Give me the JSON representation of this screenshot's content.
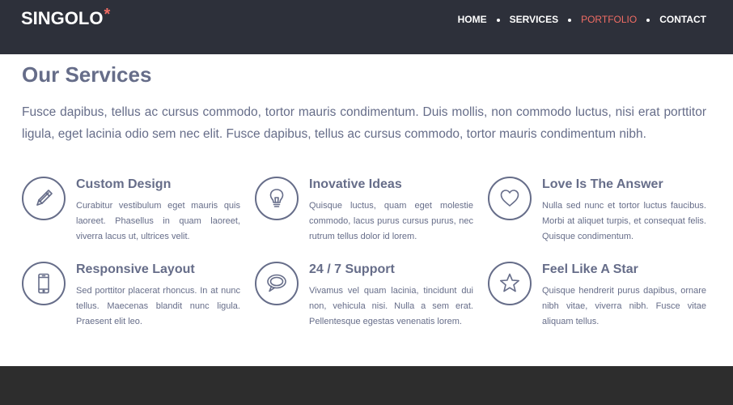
{
  "header": {
    "logo_text": "SINGOLO",
    "logo_mark": "*",
    "nav": [
      {
        "label": "HOME",
        "active": false
      },
      {
        "label": "SERVICES",
        "active": false
      },
      {
        "label": "PORTFOLIO",
        "active": true
      },
      {
        "label": "CONTACT",
        "active": false
      }
    ]
  },
  "services": {
    "title": "Our Services",
    "intro": "Fusce dapibus, tellus ac cursus commodo, tortor mauris condimentum. Duis mollis, non commodo luctus, nisi erat porttitor ligula, eget lacinia odio sem nec elit. Fusce dapibus, tellus ac cursus commodo, tortor mauris condimentum nibh.",
    "items": [
      {
        "icon": "pencil-icon",
        "title": "Custom Design",
        "text": "Curabitur vestibulum eget mauris quis laoreet. Phasellus in quam laoreet, viverra lacus ut, ultrices velit."
      },
      {
        "icon": "lightbulb-icon",
        "title": "Inovative Ideas",
        "text": "Quisque luctus, quam eget molestie commodo, lacus purus cursus purus, nec rutrum tellus dolor id lorem."
      },
      {
        "icon": "heart-icon",
        "title": "Love Is The Answer",
        "text": "Nulla sed nunc et tortor luctus faucibus. Morbi at aliquet turpis, et consequat felis. Quisque condimentum."
      },
      {
        "icon": "smartphone-icon",
        "title": "Responsive Layout",
        "text": "Sed porttitor placerat rhoncus. In at nunc tellus. Maecenas blandit nunc ligula. Praesent elit leo."
      },
      {
        "icon": "chat-bubble-icon",
        "title": "24 / 7 Support",
        "text": "Vivamus vel quam lacinia, tincidunt dui non, vehicula nisi. Nulla a sem erat. Pellentesque egestas venenatis lorem."
      },
      {
        "icon": "star-icon",
        "title": "Feel Like A Star",
        "text": "Quisque hendrerit purus dapibus, ornare nibh vitae, viverra nibh. Fusce vitae aliquam tellus."
      }
    ]
  },
  "colors": {
    "header_bg": "#2d303a",
    "accent": "#f06c64",
    "text": "#666d89",
    "footer_bg": "#2d2d2d"
  }
}
